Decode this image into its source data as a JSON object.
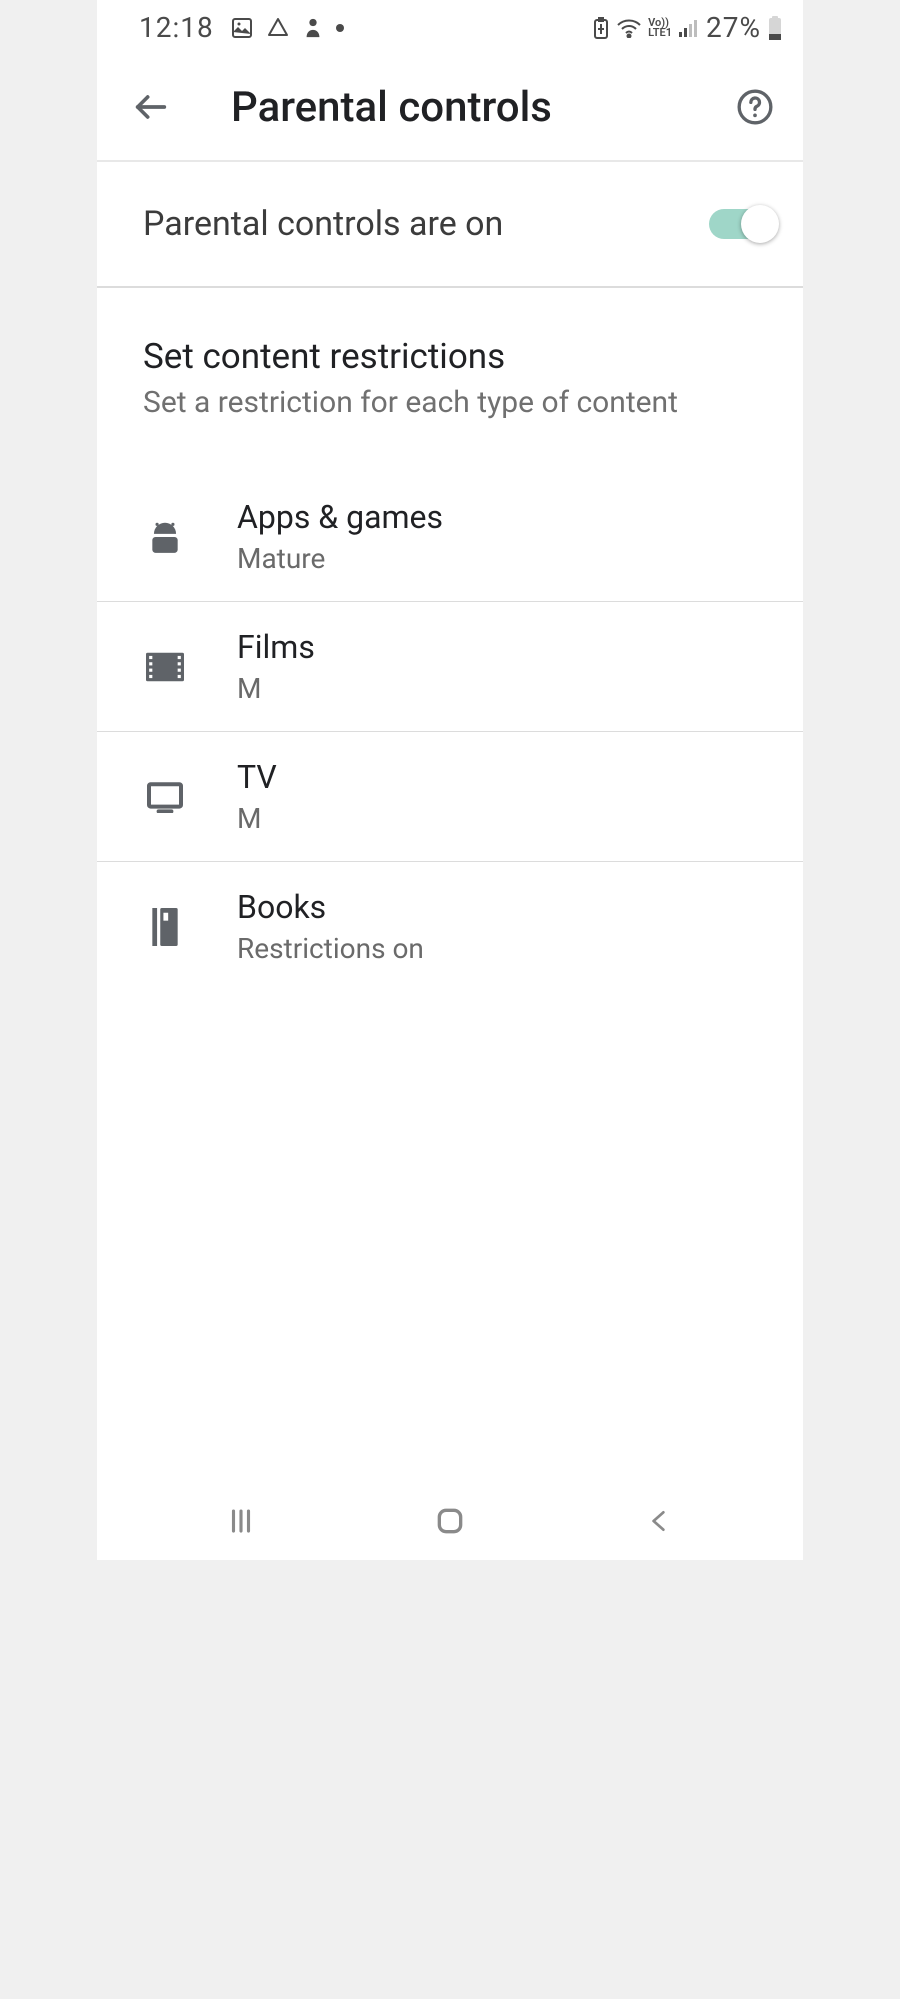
{
  "status_bar": {
    "time": "12:18",
    "battery_percent": "27%"
  },
  "app_bar": {
    "title": "Parental controls"
  },
  "toggle": {
    "label": "Parental controls are on",
    "on": true
  },
  "section": {
    "title": "Set content restrictions",
    "subtitle": "Set a restriction for each type of content"
  },
  "items": [
    {
      "icon": "android",
      "title": "Apps & games",
      "sub": "Mature"
    },
    {
      "icon": "film",
      "title": "Films",
      "sub": "M"
    },
    {
      "icon": "tv",
      "title": "TV",
      "sub": "M"
    },
    {
      "icon": "book",
      "title": "Books",
      "sub": "Restrictions on"
    }
  ]
}
